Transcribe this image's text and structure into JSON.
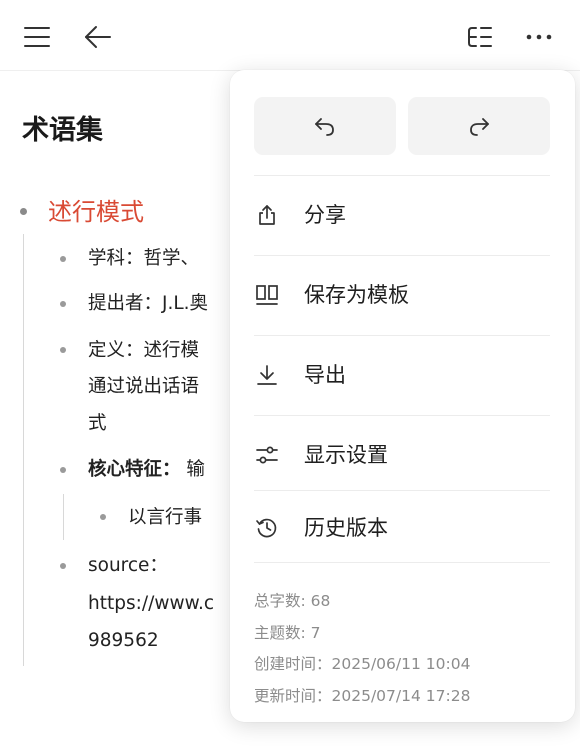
{
  "toolbar": {
    "menu_icon": "hamburger-icon",
    "back_icon": "arrow-left-icon",
    "outline_icon": "outline-collapse-icon",
    "more_icon": "more-horizontal-icon"
  },
  "document": {
    "title": "术语集",
    "root_topic": "述行模式",
    "items": [
      {
        "text": "学科：哲学、"
      },
      {
        "text": "提出者：J.L.奥"
      },
      {
        "text_lines": [
          "定义：述行模",
          "通过说出话语",
          "式"
        ]
      },
      {
        "label": "核心特征：",
        "text": " 输"
      },
      {
        "text": "以言行事"
      },
      {
        "text_lines": [
          "source：",
          "https://www.c",
          "989562"
        ]
      }
    ]
  },
  "menu": {
    "undo_icon": "undo-icon",
    "redo_icon": "redo-icon",
    "items": [
      {
        "label": "分享",
        "icon": "share-icon"
      },
      {
        "label": "保存为模板",
        "icon": "template-icon"
      },
      {
        "label": "导出",
        "icon": "download-icon"
      },
      {
        "label": "显示设置",
        "icon": "sliders-icon"
      },
      {
        "label": "历史版本",
        "icon": "history-icon"
      }
    ],
    "stats": {
      "word_count": "总字数: 68",
      "topic_count": "主题数: 7",
      "created": "创建时间：2025/06/11 10:04",
      "updated": "更新时间：2025/07/14 17:28"
    }
  },
  "colors": {
    "accent": "#d94a34",
    "menu_bg": "#ffffff",
    "button_bg": "#f3f3f3",
    "muted_text": "#8c8c8c"
  }
}
